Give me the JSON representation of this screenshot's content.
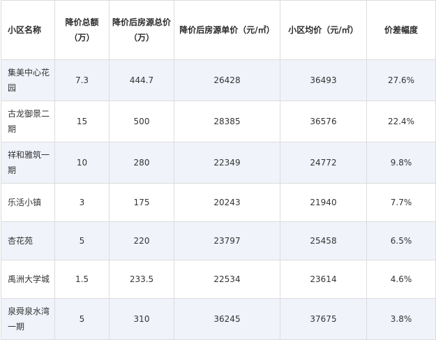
{
  "table": {
    "headers": [
      "小区名称",
      "降价总额（万）",
      "降价后房源总价（万）",
      "降价后房源单价（元/㎡）",
      "小区均价（元/㎡）",
      "价差幅度"
    ],
    "rows": [
      {
        "name": "集美中心花园",
        "cut": "7.3",
        "total": "444.7",
        "unit": "26428",
        "avg": "36493",
        "diff": "27.6%"
      },
      {
        "name": "古龙御景二期",
        "cut": "15",
        "total": "500",
        "unit": "28385",
        "avg": "36576",
        "diff": "22.4%"
      },
      {
        "name": "祥和雅筑一期",
        "cut": "10",
        "total": "280",
        "unit": "22349",
        "avg": "24772",
        "diff": "9.8%"
      },
      {
        "name": "乐活小镇",
        "cut": "3",
        "total": "175",
        "unit": "20243",
        "avg": "21940",
        "diff": "7.7%"
      },
      {
        "name": "杏花苑",
        "cut": "5",
        "total": "220",
        "unit": "23797",
        "avg": "25458",
        "diff": "6.5%"
      },
      {
        "name": "禹洲大学城",
        "cut": "1.5",
        "total": "233.5",
        "unit": "22534",
        "avg": "23614",
        "diff": "4.6%"
      },
      {
        "name": "泉舜泉水湾一期",
        "cut": "5",
        "total": "310",
        "unit": "36245",
        "avg": "37675",
        "diff": "3.8%"
      }
    ]
  }
}
